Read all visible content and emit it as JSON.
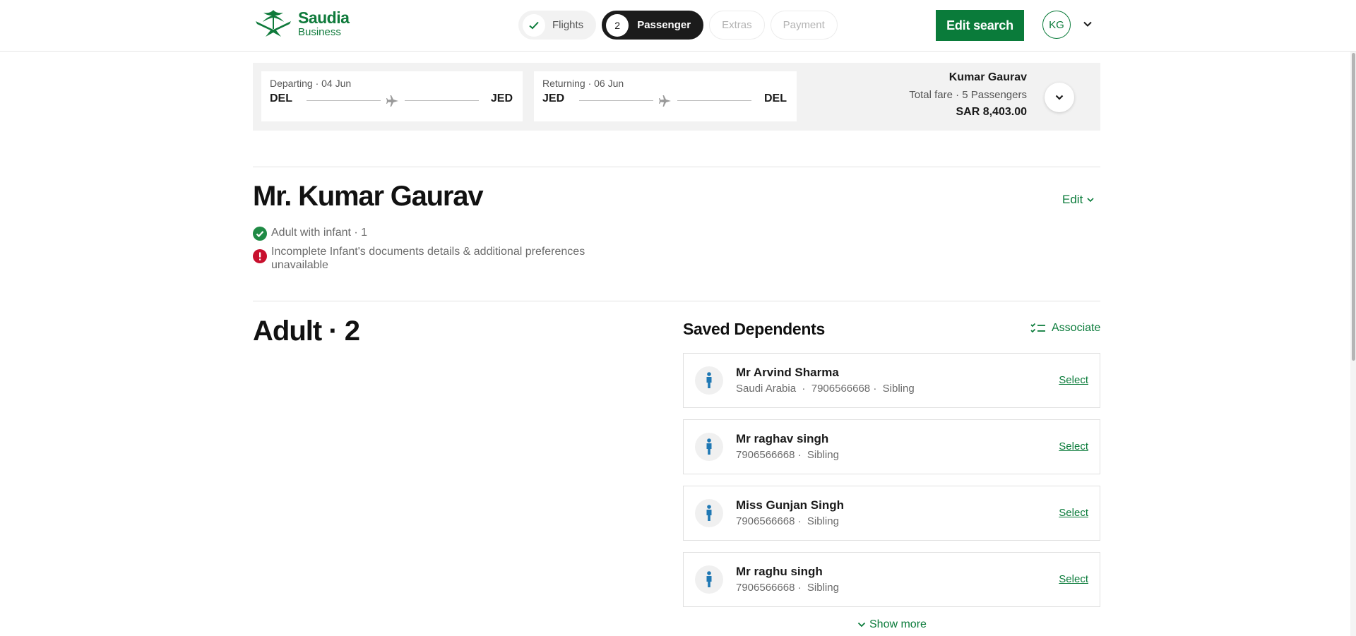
{
  "brand": {
    "name": "Saudia",
    "tier": "Business",
    "color": "#0a7b3a"
  },
  "steps": [
    {
      "label": "Flights",
      "badge": "✓",
      "state": "done"
    },
    {
      "label": "Passenger",
      "badge": "2",
      "state": "active"
    },
    {
      "label": "Extras",
      "state": "upcoming"
    },
    {
      "label": "Payment",
      "state": "upcoming"
    }
  ],
  "header": {
    "edit_search_label": "Edit search",
    "avatar_initials": "KG"
  },
  "itinerary": {
    "departing": {
      "label": "Departing · 04 Jun",
      "from": "DEL",
      "to": "JED"
    },
    "returning": {
      "label": "Returning · 06 Jun",
      "from": "JED",
      "to": "DEL"
    },
    "fare": {
      "name": "Kumar Gaurav",
      "meta": "Total fare · 5 Passengers",
      "amount": "SAR 8,403.00"
    }
  },
  "passenger": {
    "name": "Mr. Kumar Gaurav",
    "edit_label": "Edit",
    "status_ok": "Adult with infant · 1",
    "status_error": "Incomplete Infant's documents details & additional preferences unavailable"
  },
  "adult_section": {
    "title": "Adult · 2"
  },
  "dependents": {
    "title": "Saved Dependents",
    "associate_label": "Associate",
    "select_label": "Select",
    "items": [
      {
        "name": "Mr Arvind Sharma",
        "meta": "Saudi Arabia  ·  7906566668 ·  Sibling"
      },
      {
        "name": "Mr raghav singh",
        "meta": "7906566668 ·  Sibling"
      },
      {
        "name": "Miss Gunjan Singh",
        "meta": "7906566668 ·  Sibling"
      },
      {
        "name": "Mr raghu singh",
        "meta": "7906566668 ·  Sibling"
      }
    ],
    "show_more_label": "Show more"
  }
}
